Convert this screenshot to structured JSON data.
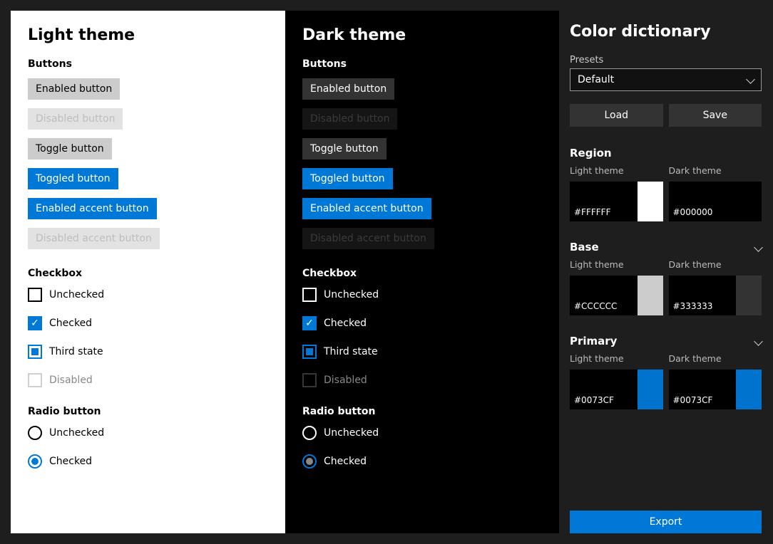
{
  "light": {
    "title": "Light theme",
    "buttons_h": "Buttons",
    "b1": "Enabled button",
    "b2": "Disabled button",
    "b3": "Toggle button",
    "b4": "Toggled button",
    "b5": "Enabled accent button",
    "b6": "Disabled accent button",
    "checkbox_h": "Checkbox",
    "cb_un": "Unchecked",
    "cb_ch": "Checked",
    "cb_th": "Third state",
    "cb_di": "Disabled",
    "radio_h": "Radio button",
    "rb_un": "Unchecked",
    "rb_ch": "Checked"
  },
  "dark": {
    "title": "Dark theme",
    "buttons_h": "Buttons",
    "b1": "Enabled button",
    "b2": "Disabled button",
    "b3": "Toggle button",
    "b4": "Toggled button",
    "b5": "Enabled accent button",
    "b6": "Disabled accent button",
    "checkbox_h": "Checkbox",
    "cb_un": "Unchecked",
    "cb_ch": "Checked",
    "cb_th": "Third state",
    "cb_di": "Disabled",
    "radio_h": "Radio button",
    "rb_un": "Unchecked",
    "rb_ch": "Checked"
  },
  "side": {
    "title": "Color dictionary",
    "presets_lbl": "Presets",
    "preset_value": "Default",
    "load": "Load",
    "save": "Save",
    "export": "Export",
    "groups": {
      "region": {
        "name": "Region",
        "lt_lbl": "Light theme",
        "dt_lbl": "Dark theme",
        "lt_val": "#FFFFFF",
        "dt_val": "#000000",
        "lt_chip": "#ffffff",
        "dt_chip": "#000000"
      },
      "base": {
        "name": "Base",
        "lt_lbl": "Light theme",
        "dt_lbl": "Dark theme",
        "lt_val": "#CCCCCC",
        "dt_val": "#333333",
        "lt_chip": "#cccccc",
        "dt_chip": "#333333"
      },
      "primary": {
        "name": "Primary",
        "lt_lbl": "Light theme",
        "dt_lbl": "Dark theme",
        "lt_val": "#0073CF",
        "dt_val": "#0073CF",
        "lt_chip": "#0073cf",
        "dt_chip": "#0073cf"
      }
    }
  }
}
